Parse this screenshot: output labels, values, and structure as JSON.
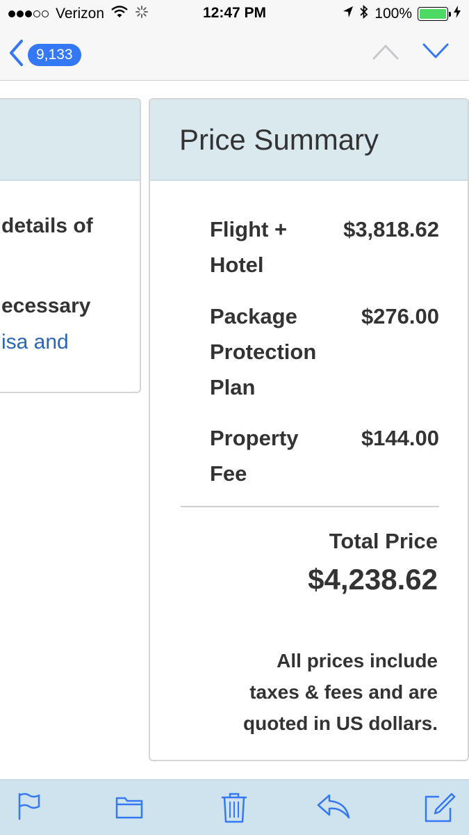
{
  "status_bar": {
    "carrier": "Verizon",
    "time": "12:47 PM",
    "battery": "100%",
    "signal_bars": 3,
    "signal_total": 5,
    "battery_level": 1.0
  },
  "nav": {
    "message_count": "9,133"
  },
  "left_card": {
    "lines": [
      {
        "text": "details of",
        "style": "bold"
      },
      {
        "text": "ecessary",
        "style": "bold"
      },
      {
        "text": "isa and",
        "style": "link"
      }
    ]
  },
  "price_summary": {
    "title": "Price Summary",
    "items": [
      {
        "label_lines": [
          "Flight +",
          "Hotel"
        ],
        "amount": "$3,818.62"
      },
      {
        "label_lines": [
          "Package",
          "Protection",
          "Plan"
        ],
        "amount": "$276.00"
      },
      {
        "label_lines": [
          "Property",
          "Fee"
        ],
        "amount": "$144.00"
      }
    ],
    "total_label": "Total Price",
    "total_amount": "$4,238.62",
    "disclaimer_lines": [
      "All prices include",
      "taxes & fees and are",
      "quoted in US dollars."
    ]
  },
  "toolbar": {
    "icons": [
      "flag-icon",
      "folder-icon",
      "trash-icon",
      "reply-icon",
      "compose-icon"
    ]
  },
  "colors": {
    "accent": "#3478f6",
    "header_bg": "#dae9ee",
    "toolbar_bg": "#cfe3ee",
    "link": "#2a66b3",
    "battery": "#4cd964"
  }
}
